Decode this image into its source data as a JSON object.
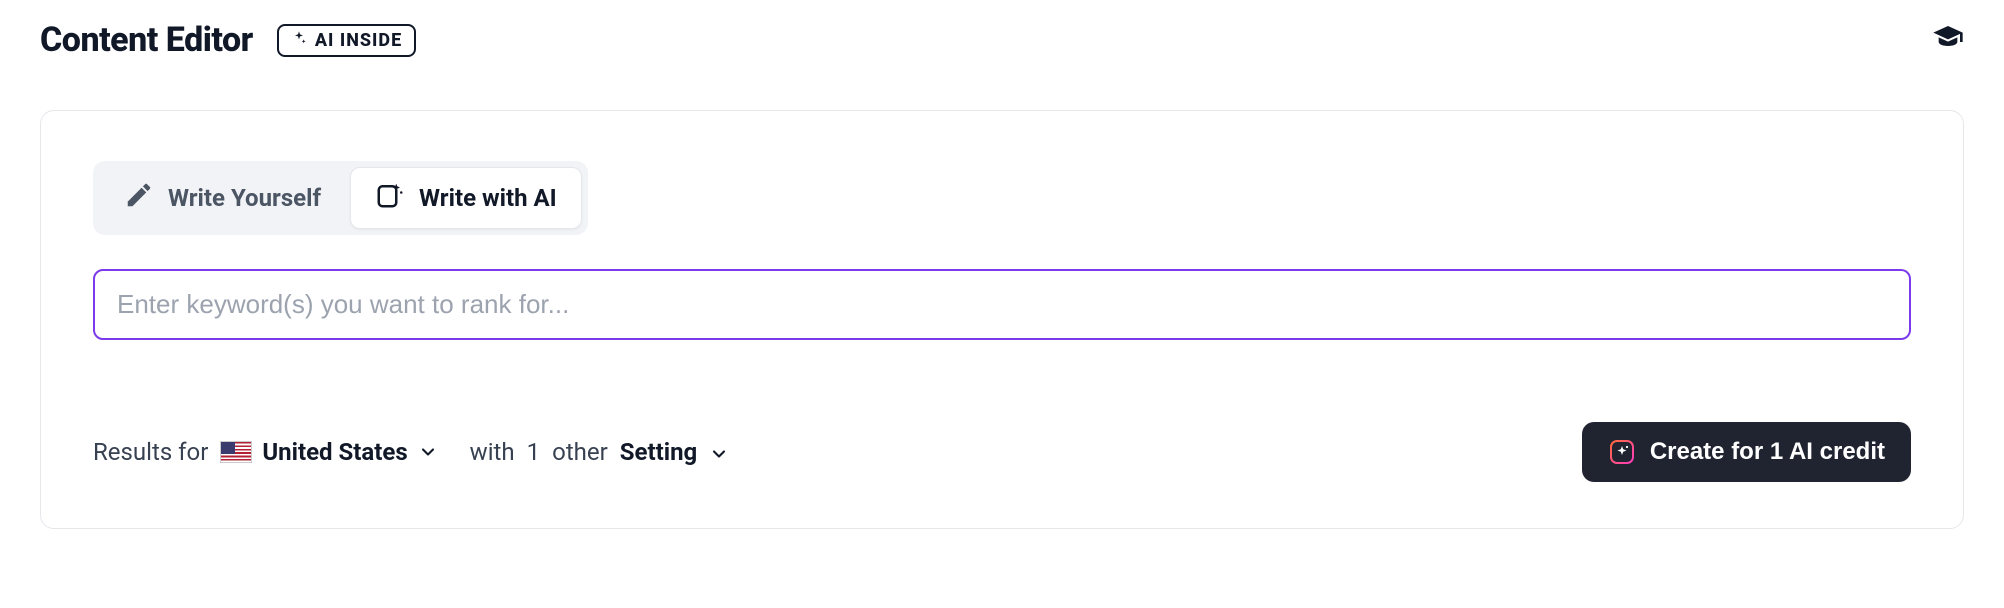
{
  "header": {
    "title": "Content Editor",
    "badge_label": "AI INSIDE"
  },
  "tabs": {
    "write_yourself": "Write Yourself",
    "write_with_ai": "Write with AI"
  },
  "input": {
    "placeholder": "Enter keyword(s) you want to rank for...",
    "value": ""
  },
  "results": {
    "prefix": "Results for",
    "country": "United States",
    "with_prefix": "with",
    "other_count": "1",
    "other_suffix": "other",
    "setting_word": "Setting"
  },
  "create": {
    "label": "Create for 1 AI credit"
  }
}
